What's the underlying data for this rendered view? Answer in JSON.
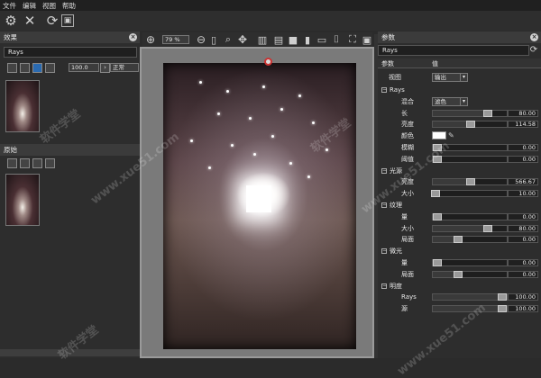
{
  "menu": [
    "文件",
    "编辑",
    "视图",
    "帮助"
  ],
  "toolbar": {
    "zoom": "79 %"
  },
  "effects_panel": {
    "title": "效果",
    "layer_name": "Rays",
    "opacity": "100.0",
    "blend_mode": "正常"
  },
  "original_panel": {
    "title": "原始"
  },
  "params_panel": {
    "title": "参数",
    "preset_name": "Rays",
    "col_param": "参数",
    "col_value": "值",
    "view_label": "视图",
    "view_value": "输出",
    "rows": [
      {
        "group": "Rays"
      },
      {
        "name": "混合",
        "dropdown": "滤色"
      },
      {
        "name": "长",
        "value": "80.00",
        "level": 0.8
      },
      {
        "name": "亮度",
        "value": "114.58",
        "level": 0.57
      },
      {
        "name": "颜色",
        "color": "#ffffff"
      },
      {
        "name": "模糊",
        "value": "0.00",
        "level": 0.0
      },
      {
        "name": "阈值",
        "value": "0.00",
        "level": 0.0
      },
      {
        "group": "光源"
      },
      {
        "name": "亮度",
        "value": "566.67",
        "level": 0.57
      },
      {
        "name": "大小",
        "value": "10.00",
        "level": 0.1
      },
      {
        "group": "纹理"
      },
      {
        "name": "量",
        "value": "0.00",
        "level": 0.0
      },
      {
        "name": "大小",
        "value": "80.00",
        "level": 0.8
      },
      {
        "name": "局面",
        "value": "0.00",
        "level": 0.4
      },
      {
        "group": "微光"
      },
      {
        "name": "量",
        "value": "0.00",
        "level": 0.0
      },
      {
        "name": "局面",
        "value": "0.00",
        "level": 0.4
      },
      {
        "group": "明度"
      },
      {
        "name": "Rays",
        "value": "100.00",
        "level": 1.0
      },
      {
        "name": "源",
        "value": "100.00",
        "level": 1.0
      }
    ]
  },
  "watermarks": [
    "软件学堂",
    "www.xue51.com",
    "软件学堂",
    "www.xue51.com",
    "软件学堂",
    "www.xue51.com"
  ]
}
